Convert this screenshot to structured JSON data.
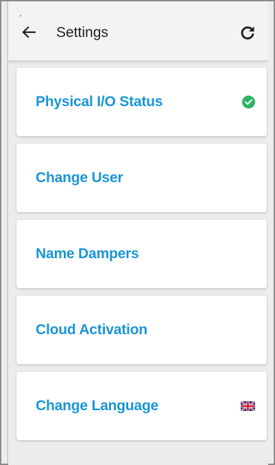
{
  "header": {
    "title": "Settings",
    "back_icon": "arrow-left-icon",
    "refresh_icon": "refresh-icon"
  },
  "settings": [
    {
      "label": "Physical I/O Status",
      "icon": "status-ok-check-icon"
    },
    {
      "label": "Change User",
      "icon": ""
    },
    {
      "label": "Name Dampers",
      "icon": ""
    },
    {
      "label": "Cloud Activation",
      "icon": ""
    },
    {
      "label": "Change Language",
      "icon": "uk-flag-icon"
    }
  ],
  "colors": {
    "accent": "#1a95d6",
    "status_ok": "#2fb36a",
    "header_bg": "#f3f3f3",
    "page_bg": "#ececec"
  }
}
